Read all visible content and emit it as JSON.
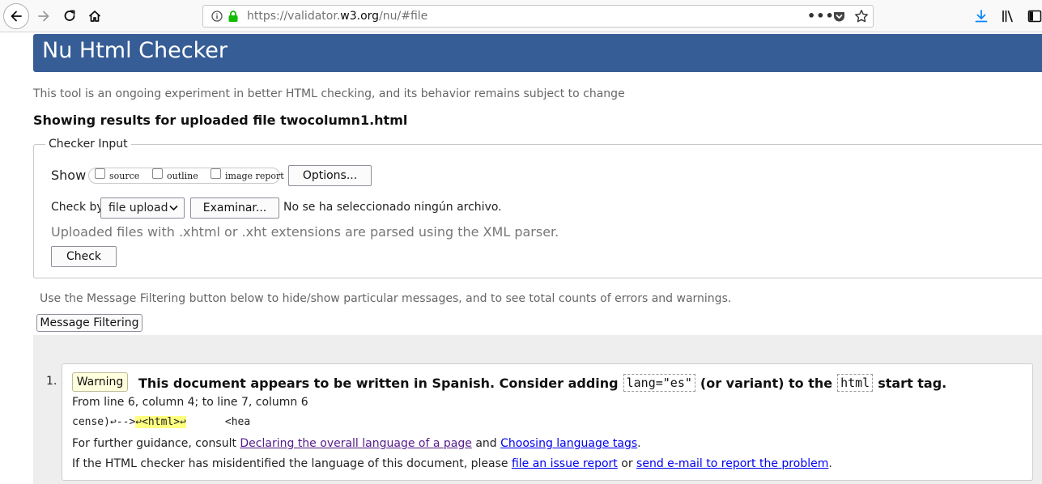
{
  "browser": {
    "url_prefix": "https://validator.",
    "url_host": "w3.org",
    "url_path": "/nu/#file",
    "icons": [
      "back-icon",
      "forward-icon",
      "reload-icon",
      "home-icon",
      "info-icon",
      "lock-icon",
      "page-actions-icon",
      "pocket-icon",
      "bookmark-star-icon",
      "downloads-icon",
      "library-icon",
      "sidebar-icon"
    ]
  },
  "page": {
    "title": "Nu Html Checker",
    "tagline": "This tool is an ongoing experiment in better HTML checking, and its behavior remains subject to change",
    "results_prefix": "Showing results for uploaded file",
    "results_file": "twocolumn1.html"
  },
  "checker_input": {
    "legend": "Checker Input",
    "show_label": "Show",
    "show_options": [
      "source",
      "outline",
      "image report"
    ],
    "options_button": "Options...",
    "check_by_label": "Check by",
    "check_by_value": "file upload",
    "browse_button": "Examinar...",
    "no_file": "No se ha seleccionado ningún archivo.",
    "xml_note": "Uploaded files with .xhtml or .xht extensions are parsed using the XML parser.",
    "check_button": "Check"
  },
  "filter": {
    "note": "Use the Message Filtering button below to hide/show particular messages, and to see total counts of errors and warnings.",
    "button": "Message Filtering"
  },
  "messages": [
    {
      "number": "1.",
      "type": "Warning",
      "text_a": "This document appears to be written in Spanish. Consider adding",
      "code_a": "lang=\"es\"",
      "text_b": "(or variant) to the",
      "code_b": "html",
      "text_c": "start tag.",
      "location": "From line 6, column 4; to line 7, column 6",
      "extract_before": "cense)↩-->",
      "extract_highlight": "↩<html>↩",
      "extract_after": "<hea",
      "guidance_prefix": "For further guidance, consult",
      "guidance_link1": "Declaring the overall language of a page",
      "guidance_and": "and",
      "guidance_link2": "Choosing language tags",
      "guidance_end": ".",
      "misid_prefix": "If the HTML checker has misidentified the language of this document, please",
      "misid_link1": "file an issue report",
      "misid_or": "or",
      "misid_link2": "send e-mail to report the problem",
      "misid_end": "."
    }
  ],
  "colors": {
    "banner": "#365d95",
    "warning_badge": "#ffffdd",
    "highlight": "#ffff80",
    "visited_link": "#551a8b",
    "link": "#0000ee",
    "download_icon": "#0a84ff"
  }
}
